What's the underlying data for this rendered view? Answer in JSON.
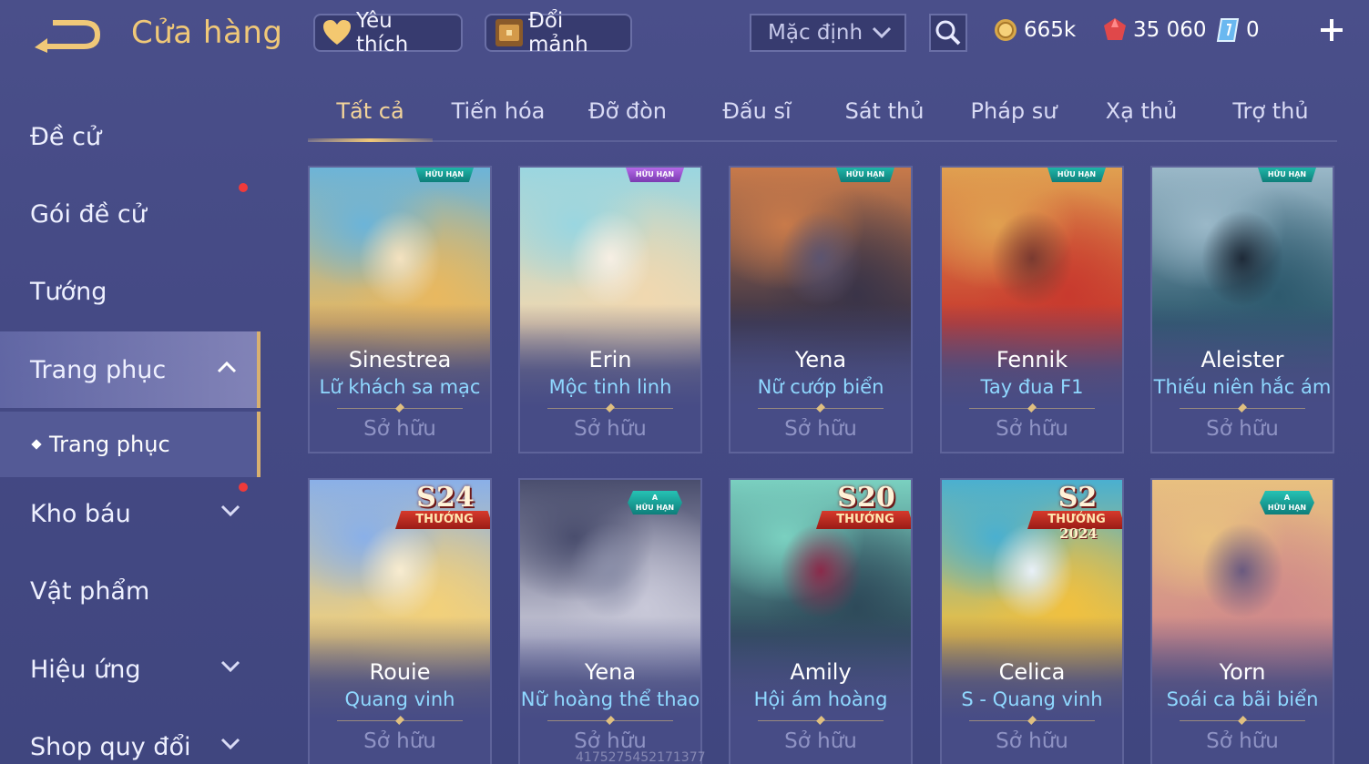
{
  "header": {
    "title": "Cửa hàng",
    "favorite_label": "Yêu thích",
    "fragment_label": "Đổi mảnh",
    "sort_value": "Mặc định",
    "currencies": {
      "gold": "665k",
      "ruby": "35 060",
      "voucher": "0"
    }
  },
  "sidebar": {
    "items": [
      {
        "label": "Đề cử",
        "badge": false
      },
      {
        "label": "Gói đề cử",
        "badge": true
      },
      {
        "label": "Tướng",
        "badge": false
      },
      {
        "label": "Trang phục",
        "expanded": true,
        "active": true
      },
      {
        "label": "Trang phục",
        "sub": true
      },
      {
        "label": "Kho báu",
        "badge": true
      },
      {
        "label": "Vật phẩm",
        "badge": false
      },
      {
        "label": "Hiệu ứng",
        "badge": false
      },
      {
        "label": "Shop quy đổi",
        "badge": false
      }
    ]
  },
  "tabs": [
    "Tất cả",
    "Tiến hóa",
    "Đỡ đòn",
    "Đấu sĩ",
    "Sát thủ",
    "Pháp sư",
    "Xạ thủ",
    "Trợ thủ"
  ],
  "active_tab": "Tất cả",
  "cards": [
    {
      "hero": "Sinestrea",
      "skin": "Lữ khách sa mạc",
      "status": "Sở hữu",
      "badge": "HỮU HẠN",
      "colors": [
        "#e8b860",
        "#6cb4d8",
        "#f4e2c0"
      ]
    },
    {
      "hero": "Erin",
      "skin": "Mộc tinh linh",
      "status": "Sở hữu",
      "badge": "HỮU HẠN",
      "badge_color": "purple",
      "colors": [
        "#f0d8b0",
        "#9ad6e0",
        "#f7efe4"
      ]
    },
    {
      "hero": "Yena",
      "skin": "Nữ cướp biển",
      "status": "Sở hữu",
      "badge": "HỮU HẠN",
      "colors": [
        "#3a3448",
        "#c87a4a",
        "#5b5470"
      ]
    },
    {
      "hero": "Fennik",
      "skin": "Tay đua F1",
      "status": "Sở hữu",
      "badge": "HỮU HẠN",
      "colors": [
        "#c83a2e",
        "#e0a050",
        "#7a3a30"
      ]
    },
    {
      "hero": "Aleister",
      "skin": "Thiếu niên hắc ám",
      "status": "Sở hữu",
      "badge": "HỮU HẠN",
      "colors": [
        "#2e5a6e",
        "#9ab8c8",
        "#1e2a38"
      ]
    },
    {
      "hero": "Rouie",
      "skin": "Quang vinh",
      "status": "Sở hữu",
      "rank_season": "S24",
      "rank_label": "THƯỞNG HẠNG",
      "colors": [
        "#f2d07a",
        "#8ab0e8",
        "#f8ecd0"
      ]
    },
    {
      "hero": "Yena",
      "skin": "Nữ hoàng thể thao",
      "status": "Sở hữu",
      "badge_a": "A",
      "badge_a_sub": "HỮU HẠN",
      "colors": [
        "#c8c8d8",
        "#4a4e6e",
        "#8a8ea8"
      ]
    },
    {
      "hero": "Amily",
      "skin": "Hội ám hoàng",
      "status": "Sở hữu",
      "rank_season": "S20",
      "rank_label": "THƯỞNG HẠNG",
      "colors": [
        "#2e4a5a",
        "#7ad0c0",
        "#8a2a4a"
      ]
    },
    {
      "hero": "Celica",
      "skin": "S - Quang vinh",
      "status": "Sở hữu",
      "rank_season": "S2",
      "rank_label": "THƯỞNG HẠNG",
      "rank_year": "2024",
      "colors": [
        "#f0c040",
        "#4ab0d0",
        "#e8f0f8"
      ]
    },
    {
      "hero": "Yorn",
      "skin": "Soái ca bãi biển",
      "status": "Sở hữu",
      "badge_a": "A",
      "badge_a_sub": "HỮU HẠN",
      "colors": [
        "#d08a8a",
        "#e8c080",
        "#6a5a80"
      ]
    }
  ],
  "watermark": "4175275452171377"
}
